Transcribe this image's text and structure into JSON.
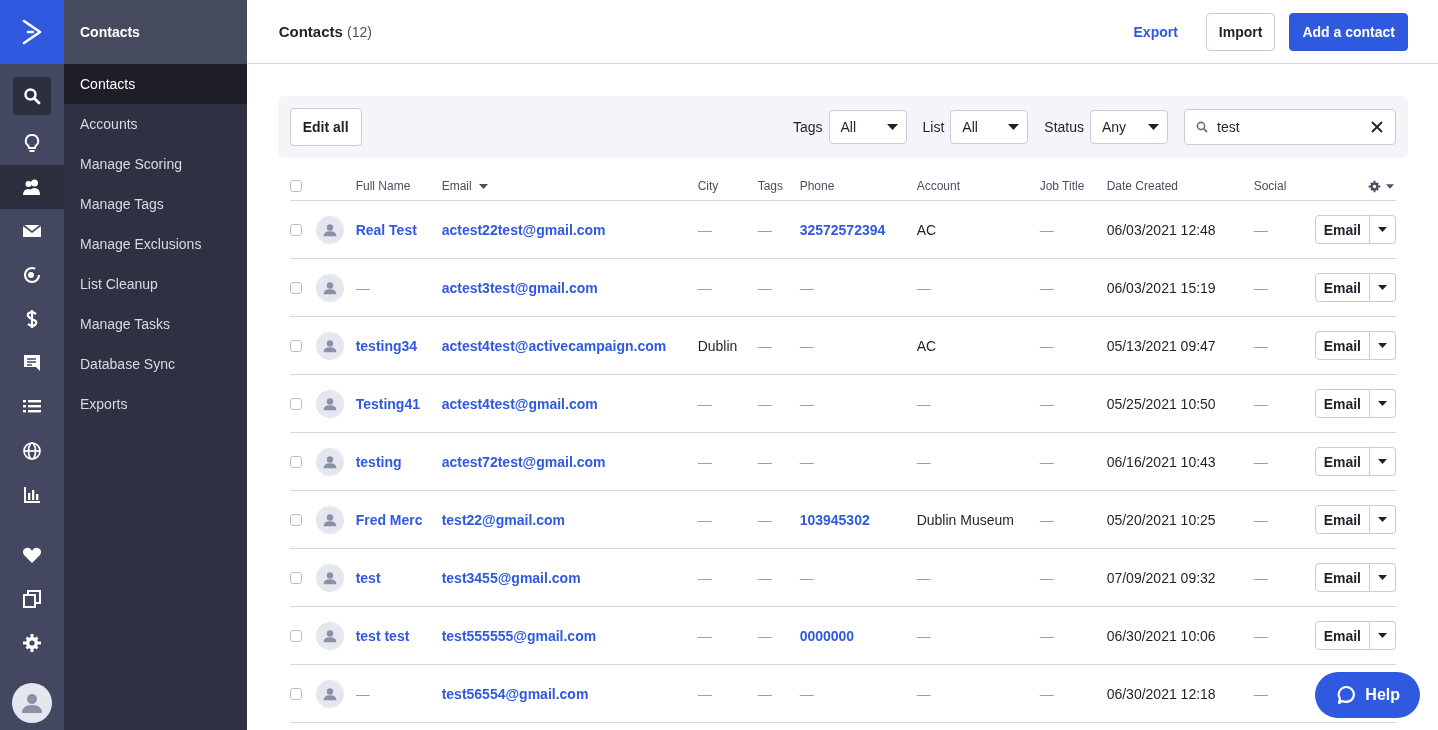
{
  "rail": {
    "items": [
      {
        "kind": "search",
        "selected": true
      },
      {
        "kind": "bulb",
        "selected": false
      },
      {
        "kind": "contacts",
        "selected": true
      },
      {
        "kind": "mail",
        "selected": false
      },
      {
        "kind": "automation",
        "selected": false
      },
      {
        "kind": "dollar",
        "selected": false
      },
      {
        "kind": "chat",
        "selected": false
      },
      {
        "kind": "list",
        "selected": false
      },
      {
        "kind": "globe",
        "selected": false
      },
      {
        "kind": "chart",
        "selected": false
      },
      {
        "kind": "heart",
        "selected": false
      },
      {
        "kind": "windows",
        "selected": false
      },
      {
        "kind": "gear",
        "selected": false
      }
    ]
  },
  "subnav": {
    "title": "Contacts",
    "items": [
      {
        "label": "Contacts",
        "selected": true
      },
      {
        "label": "Accounts",
        "selected": false
      },
      {
        "label": "Manage Scoring",
        "selected": false
      },
      {
        "label": "Manage Tags",
        "selected": false
      },
      {
        "label": "Manage Exclusions",
        "selected": false
      },
      {
        "label": "List Cleanup",
        "selected": false
      },
      {
        "label": "Manage Tasks",
        "selected": false
      },
      {
        "label": "Database Sync",
        "selected": false
      },
      {
        "label": "Exports",
        "selected": false
      }
    ]
  },
  "header": {
    "title": "Contacts",
    "count": "(12)",
    "export": "Export",
    "import": "Import",
    "add": "Add a contact"
  },
  "toolbar": {
    "edit_all": "Edit all",
    "filters": [
      {
        "label": "Tags",
        "value": "All"
      },
      {
        "label": "List",
        "value": "All"
      },
      {
        "label": "Status",
        "value": "Any"
      }
    ],
    "search": {
      "value": "test"
    }
  },
  "table": {
    "select_all_checked": false,
    "columns": [
      "Full Name",
      "Email",
      "City",
      "Tags",
      "Phone",
      "Account",
      "Job Title",
      "Date Created",
      "Social"
    ],
    "rows": [
      {
        "name": "Real Test",
        "email": "actest22test@gmail.com",
        "city": "—",
        "tags": "—",
        "phone": "32572572394",
        "account": "AC",
        "job_title": "—",
        "date": "06/03/2021 12:48",
        "social": "—",
        "action": "Email",
        "checked": false
      },
      {
        "name": "—",
        "email": "actest3test@gmail.com",
        "city": "—",
        "tags": "—",
        "phone": "—",
        "account": "—",
        "job_title": "—",
        "date": "06/03/2021 15:19",
        "social": "—",
        "action": "Email",
        "checked": false
      },
      {
        "name": "testing34",
        "email": "actest4test@activecampaign.com",
        "city": "Dublin",
        "tags": "—",
        "phone": "—",
        "account": "AC",
        "job_title": "—",
        "date": "05/13/2021 09:47",
        "social": "—",
        "action": "Email",
        "checked": false
      },
      {
        "name": "Testing41",
        "email": "actest4test@gmail.com",
        "city": "—",
        "tags": "—",
        "phone": "—",
        "account": "—",
        "job_title": "—",
        "date": "05/25/2021 10:50",
        "social": "—",
        "action": "Email",
        "checked": false
      },
      {
        "name": "testing",
        "email": "actest72test@gmail.com",
        "city": "—",
        "tags": "—",
        "phone": "—",
        "account": "—",
        "job_title": "—",
        "date": "06/16/2021 10:43",
        "social": "—",
        "action": "Email",
        "checked": false
      },
      {
        "name": "Fred Merc",
        "email": "test22@gmail.com",
        "city": "—",
        "tags": "—",
        "phone": "103945302",
        "account": "Dublin Museum",
        "job_title": "—",
        "date": "05/20/2021 10:25",
        "social": "—",
        "action": "Email",
        "checked": false
      },
      {
        "name": "test",
        "email": "test3455@gmail.com",
        "city": "—",
        "tags": "—",
        "phone": "—",
        "account": "—",
        "job_title": "—",
        "date": "07/09/2021 09:32",
        "social": "—",
        "action": "Email",
        "checked": false
      },
      {
        "name": "test test",
        "email": "test555555@gmail.com",
        "city": "—",
        "tags": "—",
        "phone": "0000000",
        "account": "—",
        "job_title": "—",
        "date": "06/30/2021 10:06",
        "social": "—",
        "action": "Email",
        "checked": false
      },
      {
        "name": "—",
        "email": "test56554@gmail.com",
        "city": "—",
        "tags": "—",
        "phone": "—",
        "account": "—",
        "job_title": "—",
        "date": "06/30/2021 12:18",
        "social": "—",
        "checked": false
      }
    ]
  },
  "help": "Help"
}
